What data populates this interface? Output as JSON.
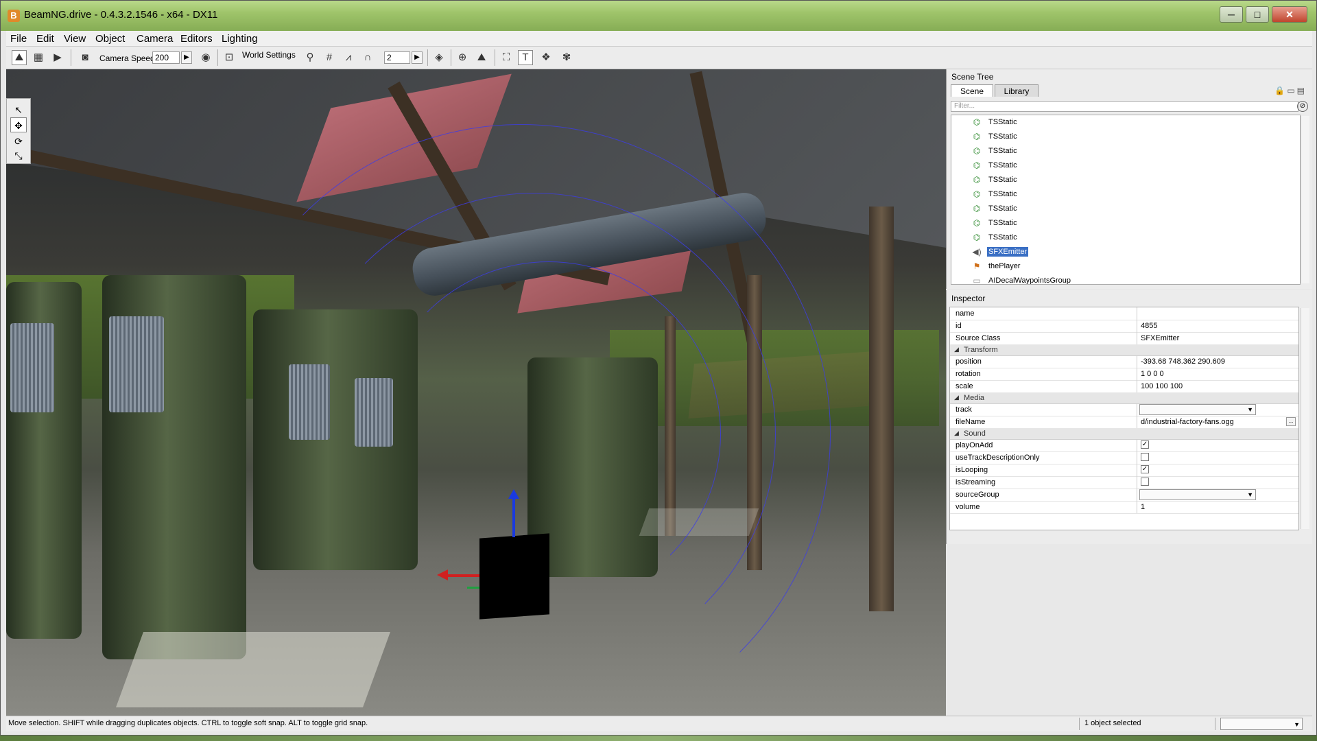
{
  "window": {
    "title": "BeamNG.drive - 0.4.3.2.1546 - x64 - DX11",
    "controls": {
      "minimize": "─",
      "maximize": "□",
      "close": "✕"
    }
  },
  "menu": [
    "File",
    "Edit",
    "View",
    "Object",
    "Camera",
    "Editors",
    "Lighting"
  ],
  "toolbar": {
    "camera_speed_label": "Camera Speed",
    "camera_speed_value": "200",
    "world_settings_label": "World Settings",
    "snap_value": "2"
  },
  "scene_tree": {
    "title": "Scene Tree",
    "tabs": [
      "Scene",
      "Library"
    ],
    "filter_placeholder": "Filter...",
    "items": [
      {
        "label": "TSStatic",
        "icon": "tsstatic-icon"
      },
      {
        "label": "TSStatic",
        "icon": "tsstatic-icon"
      },
      {
        "label": "TSStatic",
        "icon": "tsstatic-icon"
      },
      {
        "label": "TSStatic",
        "icon": "tsstatic-icon"
      },
      {
        "label": "TSStatic",
        "icon": "tsstatic-icon"
      },
      {
        "label": "TSStatic",
        "icon": "tsstatic-icon"
      },
      {
        "label": "TSStatic",
        "icon": "tsstatic-icon"
      },
      {
        "label": "TSStatic",
        "icon": "tsstatic-icon"
      },
      {
        "label": "TSStatic",
        "icon": "tsstatic-icon"
      },
      {
        "label": "SFXEmitter",
        "icon": "speaker-icon",
        "selected": true
      },
      {
        "label": "thePlayer",
        "icon": "player-icon"
      },
      {
        "label": "AIDecalWaypointsGroup",
        "icon": "folder-icon"
      }
    ]
  },
  "inspector": {
    "title": "Inspector",
    "fields": {
      "name": {
        "label": "name",
        "value": ""
      },
      "id": {
        "label": "id",
        "value": "4855"
      },
      "source_class": {
        "label": "Source Class",
        "value": "SFXEmitter"
      }
    },
    "transform": {
      "section": "Transform",
      "position": {
        "label": "position",
        "value": "-393.68 748.362 290.609"
      },
      "rotation": {
        "label": "rotation",
        "value": "1 0 0 0"
      },
      "scale": {
        "label": "scale",
        "value": "100 100 100"
      }
    },
    "media": {
      "section": "Media",
      "track": {
        "label": "track",
        "value": ""
      },
      "file_name": {
        "label": "fileName",
        "value": "d/industrial-factory-fans.ogg",
        "browse": "..."
      }
    },
    "sound": {
      "section": "Sound",
      "play_on_add": {
        "label": "playOnAdd",
        "checked": true
      },
      "use_track_description_only": {
        "label": "useTrackDescriptionOnly",
        "checked": false
      },
      "is_looping": {
        "label": "isLooping",
        "checked": true
      },
      "is_streaming": {
        "label": "isStreaming",
        "checked": false
      },
      "source_group": {
        "label": "sourceGroup",
        "value": ""
      },
      "volume": {
        "label": "volume",
        "value": "1"
      }
    }
  },
  "status": {
    "text": "Move selection.  SHIFT while dragging duplicates objects.  CTRL to toggle soft snap.  ALT to toggle grid snap.",
    "selection": "1 object selected"
  },
  "colors": {
    "title_bar": "#9fc46a",
    "selection": "#3a6fc4",
    "gizmo_x": "#d02020",
    "gizmo_z": "#1a3adf",
    "gizmo_y": "#20a040"
  }
}
